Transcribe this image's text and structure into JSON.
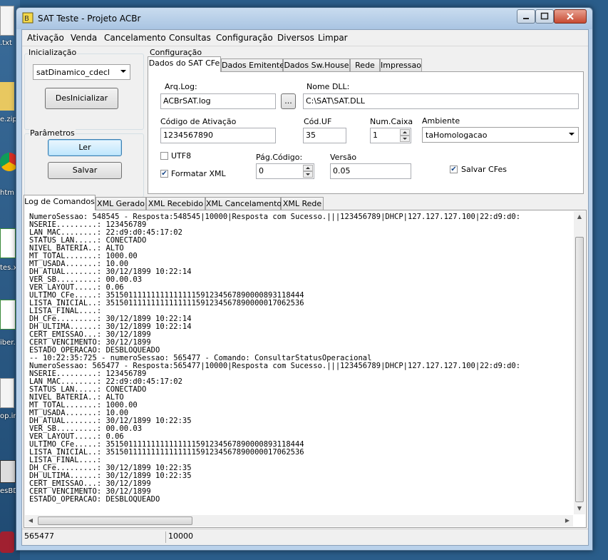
{
  "desktop": {
    "labels": [
      ".txt",
      "e.zip",
      "htm",
      "tes.xl",
      "iber.x",
      "op.in",
      "esBD"
    ]
  },
  "window": {
    "title": "SAT Teste - Projeto ACBr"
  },
  "menu": [
    "Ativação",
    "Venda",
    "Cancelamento",
    "Consultas",
    "Configuração",
    "Diversos",
    "Limpar"
  ],
  "inicializacao": {
    "group_label": "Inicialização",
    "model_value": "satDinamico_cdecl",
    "desinicializar_label": "DesInicializar"
  },
  "parametros": {
    "group_label": "Parâmetros",
    "ler_label": "Ler",
    "salvar_label": "Salvar"
  },
  "configuracao": {
    "group_label": "Configuração",
    "tabs": [
      "Dados do SAT CFe",
      "Dados Emitente",
      "Dados Sw.House",
      "Rede",
      "Impressao"
    ],
    "arqlog_label": "Arq.Log:",
    "arqlog_value": "ACBrSAT.log",
    "browse_label": "...",
    "nomedll_label": "Nome DLL:",
    "nomedll_value": "C:\\SAT\\SAT.DLL",
    "codigo_label": "Código de Ativação",
    "codigo_value": "1234567890",
    "coduf_label": "Cód.UF",
    "coduf_value": "35",
    "numcaixa_label": "Num.Caixa",
    "numcaixa_value": "1",
    "ambiente_label": "Ambiente",
    "ambiente_value": "taHomologacao",
    "utf8_label": "UTF8",
    "formatar_label": "Formatar XML",
    "pagcodigo_label": "Pág.Código:",
    "pagcodigo_value": "0",
    "versao_label": "Versão",
    "versao_value": "0.05",
    "salvar_cfes_label": "Salvar CFes",
    "utf8_checked": false,
    "formatar_checked": true,
    "salvar_cfes_checked": true
  },
  "log_tabs": [
    "Log de Comandos",
    "XML Gerado",
    "XML Recebido",
    "XML Cancelamento",
    "XML Rede"
  ],
  "log_text": "NumeroSessao: 548545 - Resposta:548545|10000|Resposta com Sucesso.|||123456789|DHCP|127.127.127.100|22:d9:d0:\nNSERIE.........: 123456789\nLAN_MAC........: 22:d9:d0:45:17:02\nSTATUS_LAN.....: CONECTADO\nNIVEL_BATERIA..: ALTO\nMT_TOTAL.......: 1000.00\nMT_USADA.......: 10.00\nDH_ATUAL.......: 30/12/1899 10:22:14\nVER_SB.........: 00.00.03\nVER_LAYOUT.....: 0.06\nULTIMO_CFe.....: 35150111111111111111591234567890000893118444\nLISTA_INICIAL..: 35150111111111111111591234567890000017062536\nLISTA_FINAL....:\nDH_CFe.........: 30/12/1899 10:22:14\nDH_ULTIMA......: 30/12/1899 10:22:14\nCERT_EMISSAO...: 30/12/1899\nCERT_VENCIMENTO: 30/12/1899\nESTADO_OPERACAO: DESBLOQUEADO\n-- 10:22:35:725 - numeroSessao: 565477 - Comando: ConsultarStatusOperacional\nNumeroSessao: 565477 - Resposta:565477|10000|Resposta com Sucesso.|||123456789|DHCP|127.127.127.100|22:d9:d0:\nNSERIE.........: 123456789\nLAN_MAC........: 22:d9:d0:45:17:02\nSTATUS_LAN.....: CONECTADO\nNIVEL_BATERIA..: ALTO\nMT_TOTAL.......: 1000.00\nMT_USADA.......: 10.00\nDH_ATUAL.......: 30/12/1899 10:22:35\nVER_SB.........: 00.00.03\nVER_LAYOUT.....: 0.06\nULTIMO_CFe.....: 35150111111111111111591234567890000893118444\nLISTA_INICIAL..: 35150111111111111111591234567890000017062536\nLISTA_FINAL....:\nDH_CFe.........: 30/12/1899 10:22:35\nDH_ULTIMA......: 30/12/1899 10:22:35\nCERT_EMISSAO...: 30/12/1899\nCERT_VENCIMENTO: 30/12/1899\nESTADO_OPERACAO: DESBLOQUEADO",
  "status": {
    "session": "565477",
    "code": "10000"
  }
}
